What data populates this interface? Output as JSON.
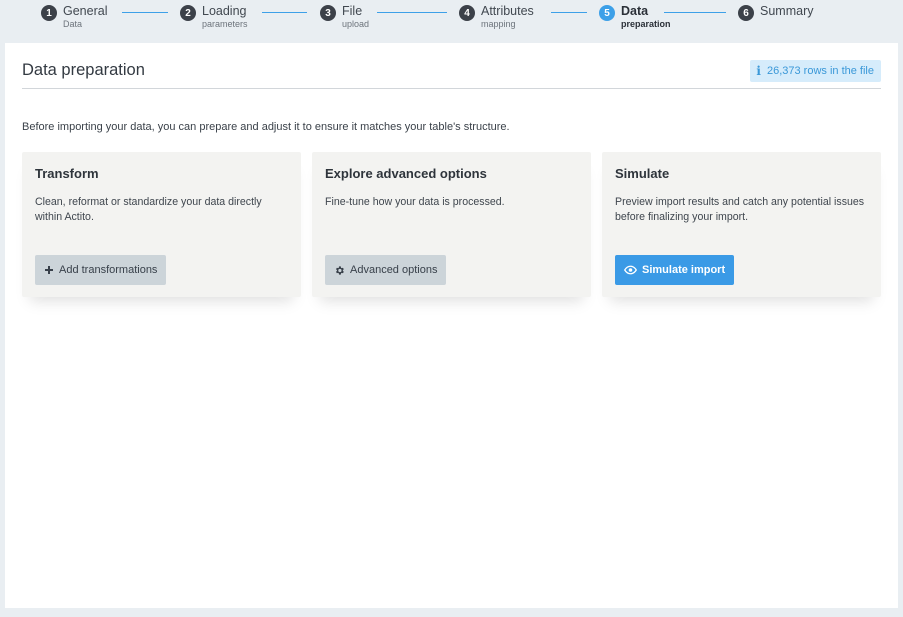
{
  "stepper": {
    "steps": [
      {
        "number": "1",
        "title": "General",
        "subtitle": "Data"
      },
      {
        "number": "2",
        "title": "Loading",
        "subtitle": "parameters"
      },
      {
        "number": "3",
        "title": "File",
        "subtitle": "upload"
      },
      {
        "number": "4",
        "title": "Attributes",
        "subtitle": "mapping"
      },
      {
        "number": "5",
        "title": "Data",
        "subtitle": "preparation"
      },
      {
        "number": "6",
        "title": "Summary",
        "subtitle": ""
      }
    ],
    "active_step": 5
  },
  "header": {
    "title": "Data preparation",
    "rows_badge": "26,373 rows in the file"
  },
  "intro_text": "Before importing your data, you can prepare and adjust it to ensure it matches your table's structure.",
  "cards": [
    {
      "title": "Transform",
      "description": "Clean, reformat or standardize your data directly within Actito.",
      "button_label": "Add transformations",
      "button_icon": "plus-icon"
    },
    {
      "title": "Explore advanced options",
      "description": "Fine-tune how your data is processed.",
      "button_label": "Advanced options",
      "button_icon": "gear-icon"
    },
    {
      "title": "Simulate",
      "description": "Preview import results and catch any potential issues before finalizing your import.",
      "button_label": "Simulate import",
      "button_icon": "eye-icon"
    }
  ],
  "colors": {
    "accent": "#3a9ae6",
    "step_active": "#3da0e8",
    "step_inactive": "#3c4149",
    "badge_bg": "#d6ecfb"
  }
}
